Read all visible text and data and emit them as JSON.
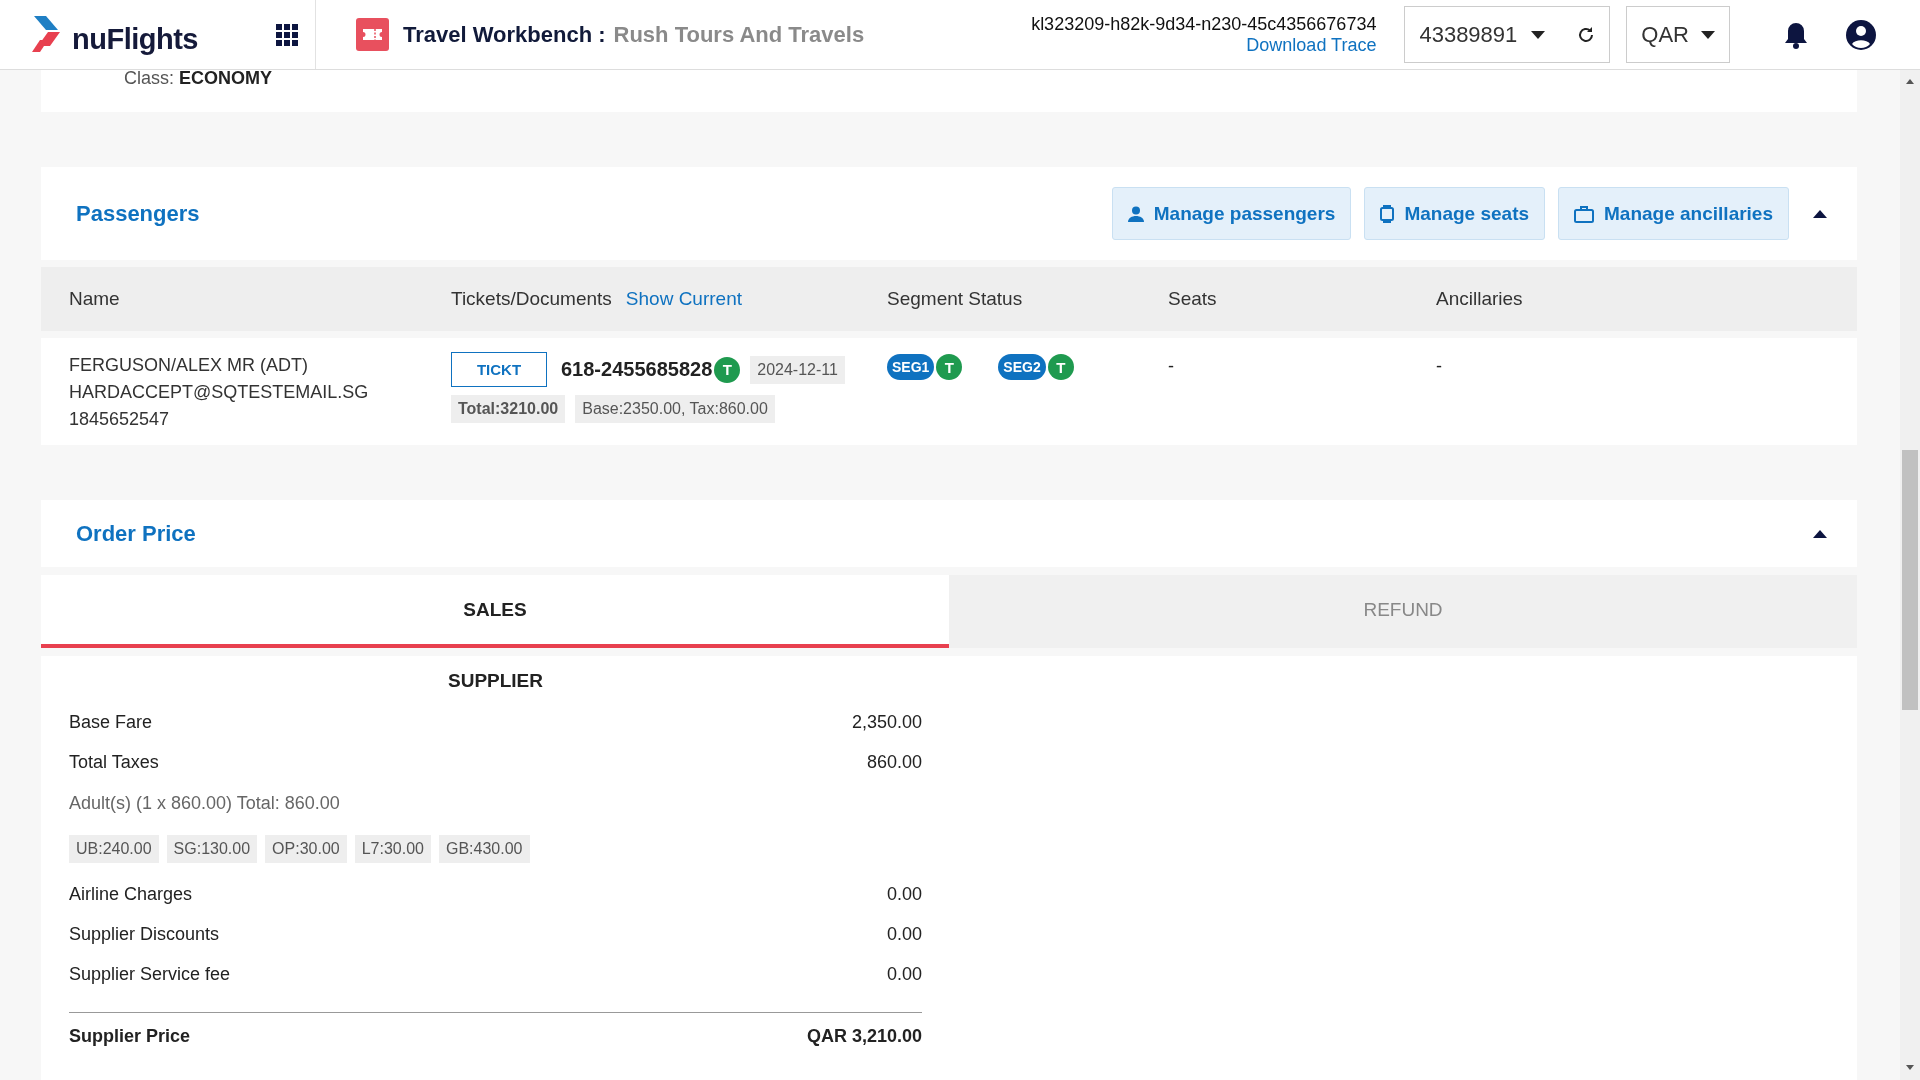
{
  "header": {
    "logo_text": "nuFlights",
    "app_title": "Travel Workbench :",
    "agency": "Rush Tours And Travels",
    "trace_id": "kl323209-h82k-9d34-n230-45c4356676734",
    "download_link": "Download Trace",
    "account": "43389891",
    "currency": "QAR"
  },
  "top_card": {
    "class_label": "Class:",
    "class_value": "ECONOMY"
  },
  "passengers": {
    "title": "Passengers",
    "expanded": true,
    "buttons": [
      {
        "label": "Manage passengers",
        "kind": "person"
      },
      {
        "label": "Manage seats",
        "kind": "seat"
      },
      {
        "label": "Manage ancillaries",
        "kind": "bag"
      }
    ],
    "columns": [
      {
        "label": "Name"
      },
      {
        "label": "Tickets/Documents",
        "link": "Show Current"
      },
      {
        "label": "Segment Status"
      },
      {
        "label": "Seats"
      },
      {
        "label": "Ancillaries"
      }
    ],
    "rows": [
      {
        "name_lines": [
          "FERGUSON/ALEX MR (ADT)",
          "HARDACCEPT@SQTESTEMAIL.SG",
          "1845652547"
        ],
        "ticket": {
          "type": "TICKT",
          "number": "618-2455685828",
          "status": "T",
          "date": "2024-12-11",
          "total": "Total:3210.00",
          "breakdown": "Base:2350.00, Tax:860.00"
        },
        "segments": [
          {
            "label": "SEG1",
            "status": "T"
          },
          {
            "label": "SEG2",
            "status": "T"
          }
        ],
        "seats": "-",
        "ancillaries": "-"
      }
    ]
  },
  "order_price": {
    "title": "Order Price",
    "expanded": true,
    "tabs": [
      {
        "label": "SALES",
        "selected": true
      },
      {
        "label": "REFUND",
        "selected": false
      }
    ],
    "supplier": {
      "heading": "SUPPLIER",
      "items": [
        {
          "kind": "line",
          "label": "Base Fare",
          "value": "2,350.00"
        },
        {
          "kind": "line",
          "label": "Total Taxes",
          "value": "860.00"
        },
        {
          "kind": "note",
          "label": "Adult(s) (1 x 860.00) Total: 860.00"
        },
        {
          "kind": "chips",
          "chips": [
            "UB:240.00",
            "SG:130.00",
            "OP:30.00",
            "L7:30.00",
            "GB:430.00"
          ]
        },
        {
          "kind": "line",
          "label": "Airline Charges",
          "value": "0.00"
        },
        {
          "kind": "line",
          "label": "Supplier Discounts",
          "value": "0.00"
        },
        {
          "kind": "line",
          "label": "Supplier Service fee",
          "value": "0.00"
        },
        {
          "kind": "total",
          "label": "Supplier Price",
          "value": "QAR 3,210.00"
        }
      ]
    }
  }
}
